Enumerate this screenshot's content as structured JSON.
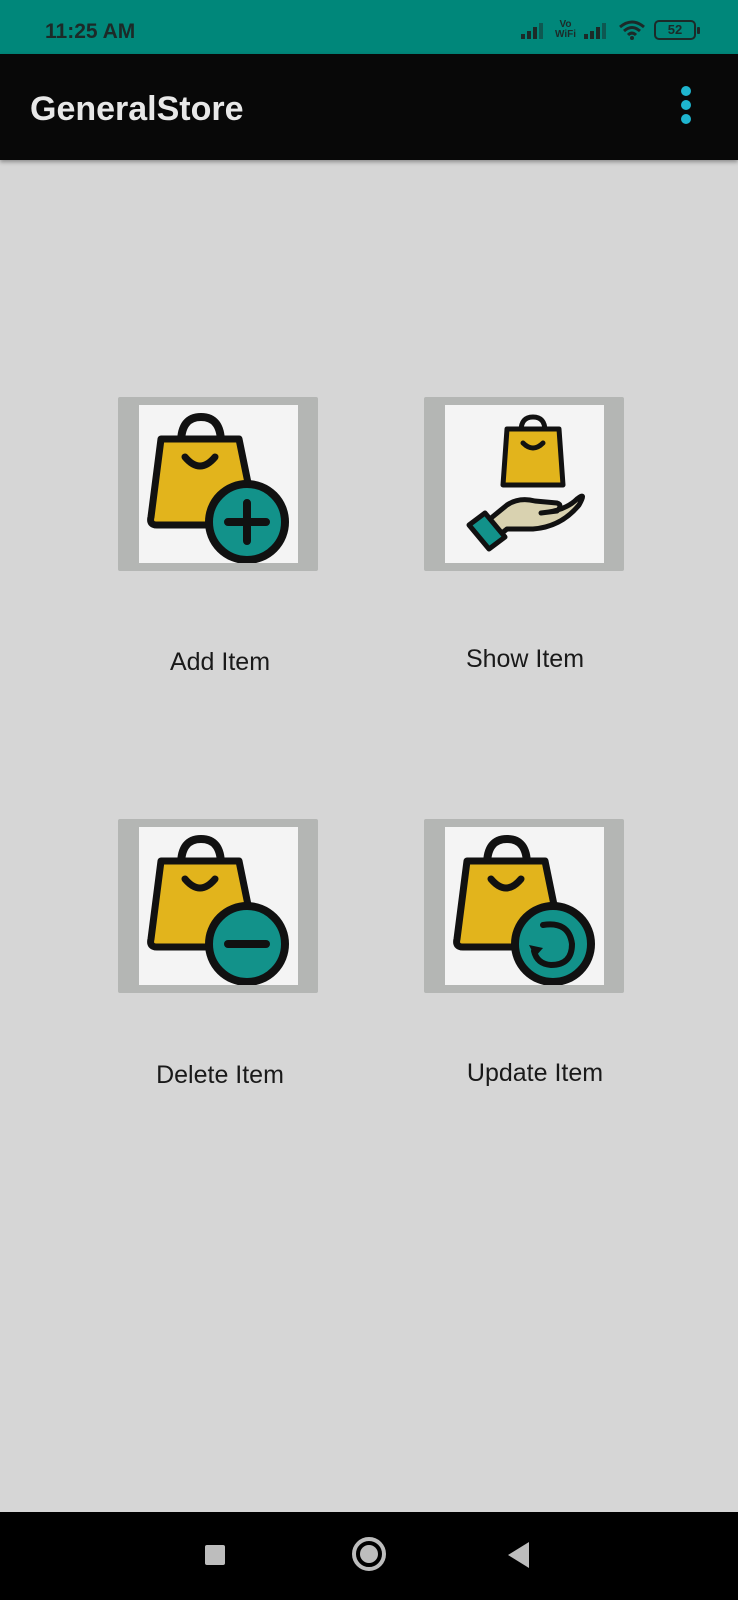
{
  "status_bar": {
    "time": "11:25 AM",
    "vowifi_top": "Vo",
    "vowifi_bottom": "WiFi",
    "battery": "52",
    "icons": [
      "signal-icon",
      "vowifi-icon",
      "signal-icon",
      "wifi-icon",
      "battery-icon"
    ]
  },
  "app_bar": {
    "title": "GeneralStore",
    "menu_icon": "overflow-menu-icon"
  },
  "menu": {
    "items": [
      {
        "label": "Add Item",
        "icon": "bag-add-icon"
      },
      {
        "label": "Show Item",
        "icon": "bag-hand-icon"
      },
      {
        "label": "Delete Item",
        "icon": "bag-remove-icon"
      },
      {
        "label": "Update Item",
        "icon": "bag-refresh-icon"
      }
    ]
  },
  "colors": {
    "status_bar": "#00877a",
    "app_bar": "#080808",
    "background": "#d6d6d6",
    "bag_yellow": "#e2b41c",
    "badge_teal": "#12928a",
    "overflow_dots": "#1eb5cf"
  },
  "nav_bar": {
    "icons": [
      "recents-square-icon",
      "home-circle-icon",
      "back-triangle-icon"
    ]
  }
}
